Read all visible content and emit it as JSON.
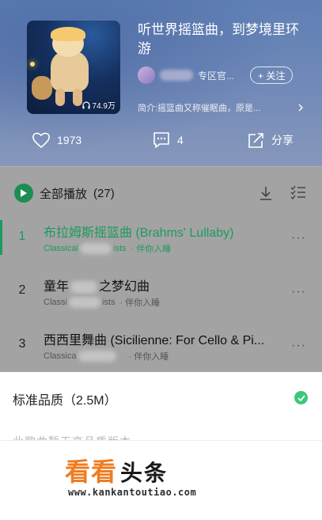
{
  "album": {
    "title": "听世界摇篮曲，到梦境里环游",
    "play_count": "74.9万",
    "author_suffix": "专区官...",
    "follow_label": "+ 关注",
    "intro": "简介:摇篮曲又称催眠曲，原是..."
  },
  "actions": {
    "likes": "1973",
    "comments": "4",
    "share_label": "分享"
  },
  "list": {
    "play_all_label": "全部播放",
    "count": "(27)",
    "tracks": [
      {
        "num": "1",
        "name": "布拉姆斯摇篮曲 (Brahms' Lullaby)",
        "artist_prefix": "Classical",
        "artist_suffix": "ists",
        "tag": "· 伴你入睡"
      },
      {
        "num": "2",
        "name": "童年",
        "name_suffix": "之梦幻曲",
        "artist_prefix": "Classi",
        "artist_suffix": "ists",
        "tag": "· 伴你入睡"
      },
      {
        "num": "3",
        "name": "西西里舞曲 (Sicilienne: For Cello & Pi...",
        "artist_prefix": "Classica",
        "artist_suffix": "",
        "tag": "· 伴你入睡"
      }
    ]
  },
  "sheet": {
    "quality_label": "标准品质（2.5M）",
    "faded_text": "此歌曲暂无高品质版本"
  },
  "watermark": {
    "brand_red": "看看",
    "brand_black": "头条",
    "url": "www.kankantoutiao.com"
  },
  "colors": {
    "accent_green": "#1c9b5e",
    "check_green": "#3cc77a",
    "brand_orange": "#f07c22"
  }
}
